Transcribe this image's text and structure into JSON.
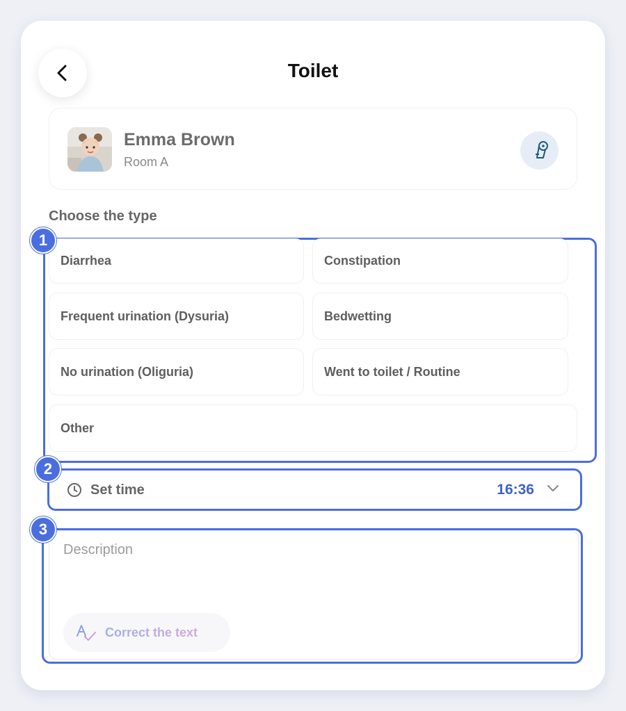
{
  "header": {
    "title": "Toilet",
    "back_icon": "chevron-left-icon"
  },
  "child": {
    "name": "Emma Brown",
    "room": "Room A",
    "category_icon": "toilet-paper-icon"
  },
  "type_section": {
    "label": "Choose the type",
    "options": [
      "Diarrhea",
      "Constipation",
      "Frequent urination (Dysuria)",
      "Bedwetting",
      "No urination (Oliguria)",
      "Went to toilet / Routine",
      "Other"
    ]
  },
  "time": {
    "label": "Set time",
    "value": "16:36",
    "icon": "clock-icon"
  },
  "description": {
    "placeholder": "Description",
    "correct_label": "Correct the text"
  },
  "annotations": {
    "badges": [
      "1",
      "2",
      "3"
    ],
    "accent": "#4a6ee0"
  }
}
